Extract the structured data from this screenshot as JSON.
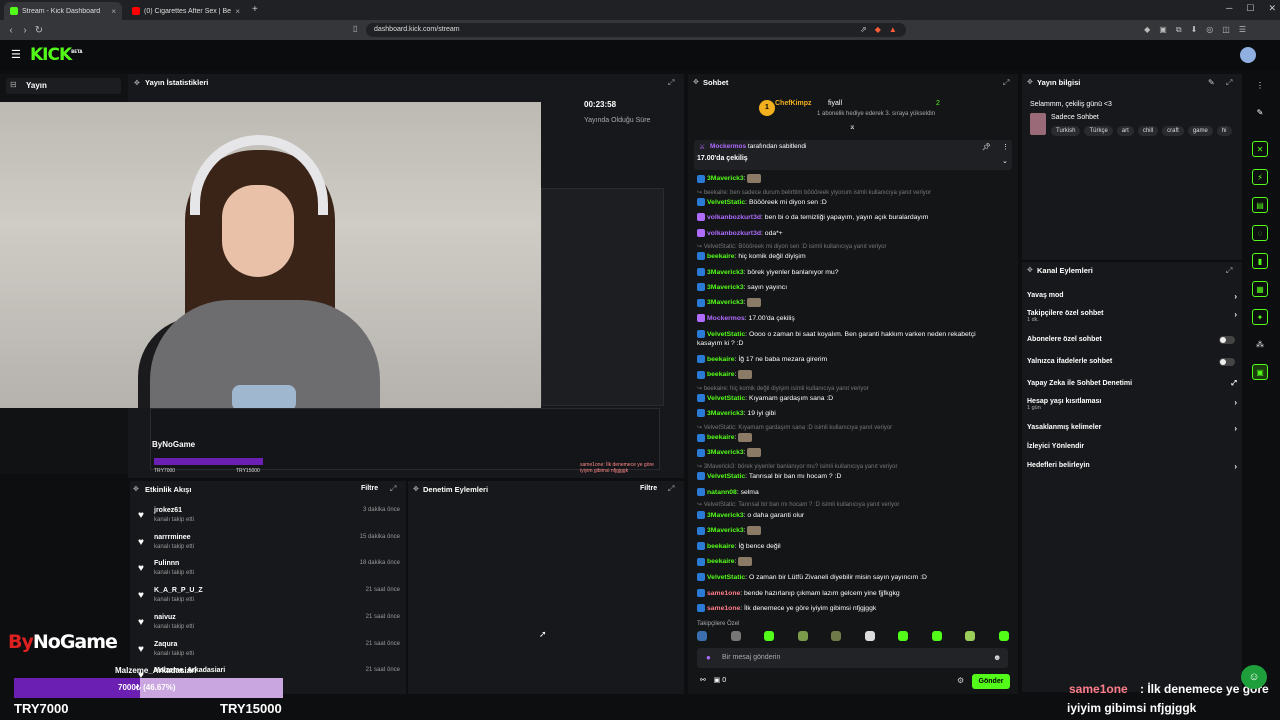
{
  "browser": {
    "tabs": [
      {
        "title": "Stream - Kick Dashboard",
        "close": "×",
        "fav_color": "#53fc18"
      },
      {
        "title": "(0) Cigarettes After Sex | Best Pla",
        "close": "×",
        "fav_color": "#ff0000"
      }
    ],
    "new_tab": "+",
    "url": "dashboard.kick.com/stream"
  },
  "app": {
    "logo": "KICK",
    "logo_sup": "BETA"
  },
  "leftnav": {
    "active_item": "Yayın"
  },
  "stats": {
    "title": "Yayın İstatistikleri",
    "timer": "00:23:58",
    "timer_label": "Yayında Olduğu Süre"
  },
  "obs_overlay": {
    "brand": "ByNoGame",
    "min": "TRY7000",
    "max": "TRY15000",
    "snippet": "same1one: İlk denemece ye göre iyiyim gibimsi nfjgjggk"
  },
  "activity": {
    "title": "Etkinlik Akışı",
    "filter": "Filtre",
    "items": [
      {
        "name": "jrokez61",
        "sub": "kanalı takip etti",
        "time": "3 dakika önce"
      },
      {
        "name": "narrrminee",
        "sub": "kanalı takip etti",
        "time": "15 dakika önce"
      },
      {
        "name": "Fulinnn",
        "sub": "kanalı takip etti",
        "time": "18 dakika önce"
      },
      {
        "name": "K_A_R_P_U_Z",
        "sub": "kanalı takip etti",
        "time": "21 saat önce"
      },
      {
        "name": "naivuz",
        "sub": "kanalı takip etti",
        "time": "21 saat önce"
      },
      {
        "name": "Zaqura",
        "sub": "kanalı takip etti",
        "time": "21 saat önce"
      },
      {
        "name": "Malzeme_Arkadasiari",
        "sub": "",
        "time": "21 saat önce"
      }
    ]
  },
  "moderation": {
    "title": "Denetim Eylemleri",
    "filter": "Filtre"
  },
  "chat": {
    "title": "Sohbet",
    "leader": {
      "rank": "1",
      "name": "ChefKimpz",
      "user": "fiyall",
      "count": "2",
      "sub": "1 abonelik hediye ederek 3. sıraya yükseldin"
    },
    "pinned": {
      "by_user": "Mockermos",
      "by_text": " tarafından sabitlendi",
      "message": "17.00'da çekiliş"
    },
    "lines": [
      {
        "user": "3Maverick3",
        "text": ":",
        "color": "#53fc18",
        "reply": false
      },
      {
        "user": "",
        "text": "beekaire: ben sadece durum belirttim böööreek yiyorum  isimli kullanıcıya yanıt veriyor",
        "color": "#777",
        "reply": true
      },
      {
        "user": "VelvetStatic",
        "text": ": Böööreek mi diyon sen :D",
        "color": "#53fc18",
        "reply": false
      },
      {
        "user": "volkanbozkurt3d",
        "text": ": ben bi o da temizliği yapayım, yayın açık buralardayım",
        "color": "#b06cff",
        "reply": false
      },
      {
        "user": "volkanbozkurt3d",
        "text": ": oda*+",
        "color": "#b06cff",
        "reply": false
      },
      {
        "user": "",
        "text": "VelvetStatic: Böööreek mi diyon sen :D isimli kullanıcıya yanıt veriyor",
        "color": "#777",
        "reply": true
      },
      {
        "user": "beekaire",
        "text": ": hiç komik değil diyişim",
        "color": "#53fc18",
        "reply": false
      },
      {
        "user": "3Maverick3",
        "text": ": börek yiyenler banlanıyor mu?",
        "color": "#53fc18",
        "reply": false
      },
      {
        "user": "3Maverick3",
        "text": ": sayın yayıncı",
        "color": "#53fc18",
        "reply": false
      },
      {
        "user": "3Maverick3",
        "text": ":",
        "color": "#53fc18",
        "reply": false
      },
      {
        "user": "Mockermos",
        "text": ": 17.00'da çekiliş",
        "color": "#b06cff",
        "reply": false
      },
      {
        "user": "VelvetStatic",
        "text": ": Oooo o zaman bi saat koyalım. Ben garanti hakkım varken neden rekabetçi",
        "color": "#53fc18",
        "reply": false
      },
      {
        "user": "",
        "text": "kasayım ki ? :D",
        "color": "#fff",
        "reply": false
      },
      {
        "user": "beekaire",
        "text": ": İğ 17 ne baba mezara girerim",
        "color": "#53fc18",
        "reply": false
      },
      {
        "user": "beekaire",
        "text": ":",
        "color": "#53fc18",
        "reply": false
      },
      {
        "user": "",
        "text": "beekaire: hiç komik değil diyişim  isimli kullanıcıya yanıt veriyor",
        "color": "#777",
        "reply": true
      },
      {
        "user": "VelvetStatic",
        "text": ": Kıyamam gardaşım sana :D",
        "color": "#53fc18",
        "reply": false
      },
      {
        "user": "3Maverick3",
        "text": ": 19 iyi gibi",
        "color": "#53fc18",
        "reply": false
      },
      {
        "user": "",
        "text": "VelvetStatic: Kıyamam gardaşım sana :D isimli kullanıcıya yanıt veriyor",
        "color": "#777",
        "reply": true
      },
      {
        "user": "beekaire",
        "text": ":",
        "color": "#53fc18",
        "reply": false
      },
      {
        "user": "3Maverick3",
        "text": ":",
        "color": "#53fc18",
        "reply": false
      },
      {
        "user": "",
        "text": "3Maverick3: börek yiyenler banlanıyor mu? isimli kullanıcıya yanıt veriyor",
        "color": "#777",
        "reply": true
      },
      {
        "user": "VelvetStatic",
        "text": ": Tanrısal bir ban mı hocam ? :D",
        "color": "#53fc18",
        "reply": false
      },
      {
        "user": "natann08",
        "text": ": selma",
        "color": "#53fc18",
        "reply": false
      },
      {
        "user": "",
        "text": "VelvetStatic: Tanrısal bir ban mı hocam ? :D isimli kullanıcıya yanıt veriyor",
        "color": "#777",
        "reply": true
      },
      {
        "user": "3Maverick3",
        "text": ": o daha garanti olur",
        "color": "#53fc18",
        "reply": false
      },
      {
        "user": "3Maverick3",
        "text": ":",
        "color": "#53fc18",
        "reply": false
      },
      {
        "user": "beekaire",
        "text": ": İğ bence değil",
        "color": "#53fc18",
        "reply": false
      },
      {
        "user": "beekaire",
        "text": ":",
        "color": "#53fc18",
        "reply": false
      },
      {
        "user": "VelvetStatic",
        "text": ": O zaman bir Lütfü Zivaneli diyebilir misin sayın yayıncım :D",
        "color": "#53fc18",
        "reply": false
      },
      {
        "user": "same1one",
        "text": ": bende hazırlanıp çıkmam lazım gelcem yine fjjfkgkg",
        "color": "#ff7d8a",
        "reply": false
      },
      {
        "user": "same1one",
        "text": ": İlk denemece ye göre iyiyim gibimsi nfjgjggk",
        "color": "#ff7d8a",
        "reply": false
      }
    ],
    "fav_label": "Takipçilere Özel",
    "input_placeholder": "Bir mesaj gönderin",
    "bottom_count": "0",
    "send_label": "Gönder"
  },
  "stream_info": {
    "title": "Yayın bilgisi",
    "stream_title": "Selammm, çekiliş günü <3",
    "category": "Sadece Sohbet",
    "tags": [
      "Turkish",
      "Türkçe",
      "art",
      "chill",
      "craft",
      "game",
      "hi"
    ]
  },
  "channel_actions": {
    "title": "Kanal Eylemleri",
    "items": [
      {
        "label": "Yavaş mod",
        "sub": "",
        "control": "arrow"
      },
      {
        "label": "Takipçilere özel sohbet",
        "sub": "1 dk.",
        "control": "arrow"
      },
      {
        "label": "Abonelere özel sohbet",
        "sub": "",
        "control": "toggle"
      },
      {
        "label": "Yalnızca ifadelerle sohbet",
        "sub": "",
        "control": "toggle"
      },
      {
        "label": "Yapay Zeka ile Sohbet Denetimi",
        "sub": "",
        "control": "link"
      },
      {
        "label": "Hesap yaşı kısıtlaması",
        "sub": "1 gün",
        "control": "arrow"
      },
      {
        "label": "Yasaklanmış kelimeler",
        "sub": "",
        "control": "arrow"
      },
      {
        "label": "İzleyici Yönlendir",
        "sub": "",
        "control": "none"
      },
      {
        "label": "Hedefleri belirleyin",
        "sub": "",
        "control": "arrow"
      }
    ]
  },
  "overlay": {
    "logo_a": "By",
    "logo_b": "NoGame",
    "goal_label": "Malzeme_Arkadasiari",
    "goal_progress_text": "7000₺ (46.67%)",
    "goal_fraction": 0.4667,
    "goal_min": "TRY7000",
    "goal_max": "TRY15000",
    "chat_name": "same1one",
    "chat_msg": ": İlk denemece ye göre",
    "chat_msg2": "iyiyim gibimsi nfjgjggk"
  },
  "colors": {
    "brand": "#53fc18",
    "panel": "#17181b",
    "bg": "#0d0e10",
    "goal": "#6b1fb3"
  }
}
